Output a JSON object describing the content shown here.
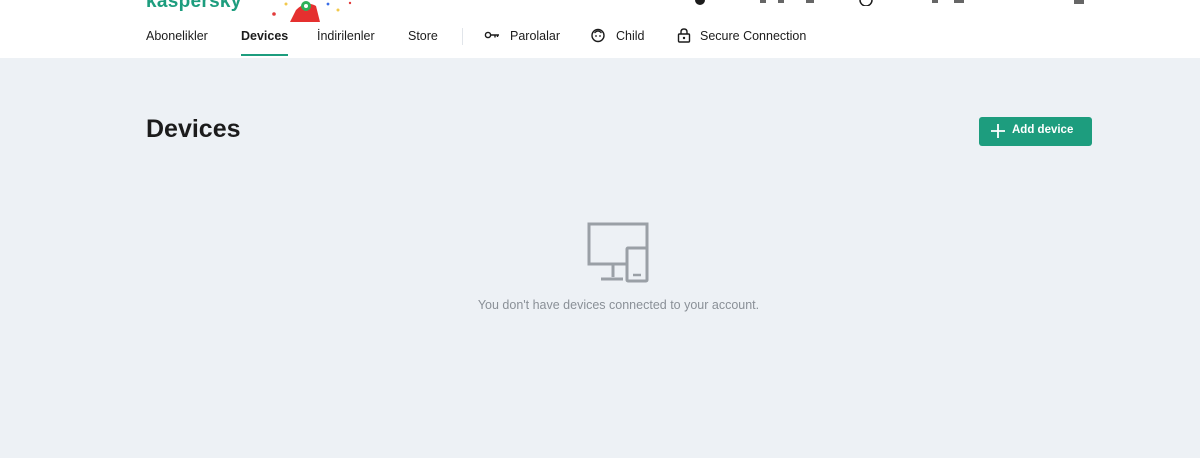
{
  "brand": {
    "logo_text": "kaspersky",
    "accent_color": "#1d9d7e"
  },
  "nav": {
    "items": [
      {
        "label": "Abonelikler",
        "active": false
      },
      {
        "label": "Devices",
        "active": true
      },
      {
        "label": "İndirilenler",
        "active": false
      },
      {
        "label": "Store",
        "active": false
      },
      {
        "label": "Parolalar",
        "active": false,
        "icon": "key-icon"
      },
      {
        "label": "Child",
        "active": false,
        "icon": "child-face-icon"
      },
      {
        "label": "Secure Connection",
        "active": false,
        "icon": "lock-icon"
      }
    ]
  },
  "main": {
    "title": "Devices",
    "add_button_label": "Add device",
    "add_button_icon": "plus-icon",
    "empty_icon": "devices-icon",
    "empty_message": "You don't have devices connected to your account.",
    "background_color": "#edf1f5"
  }
}
